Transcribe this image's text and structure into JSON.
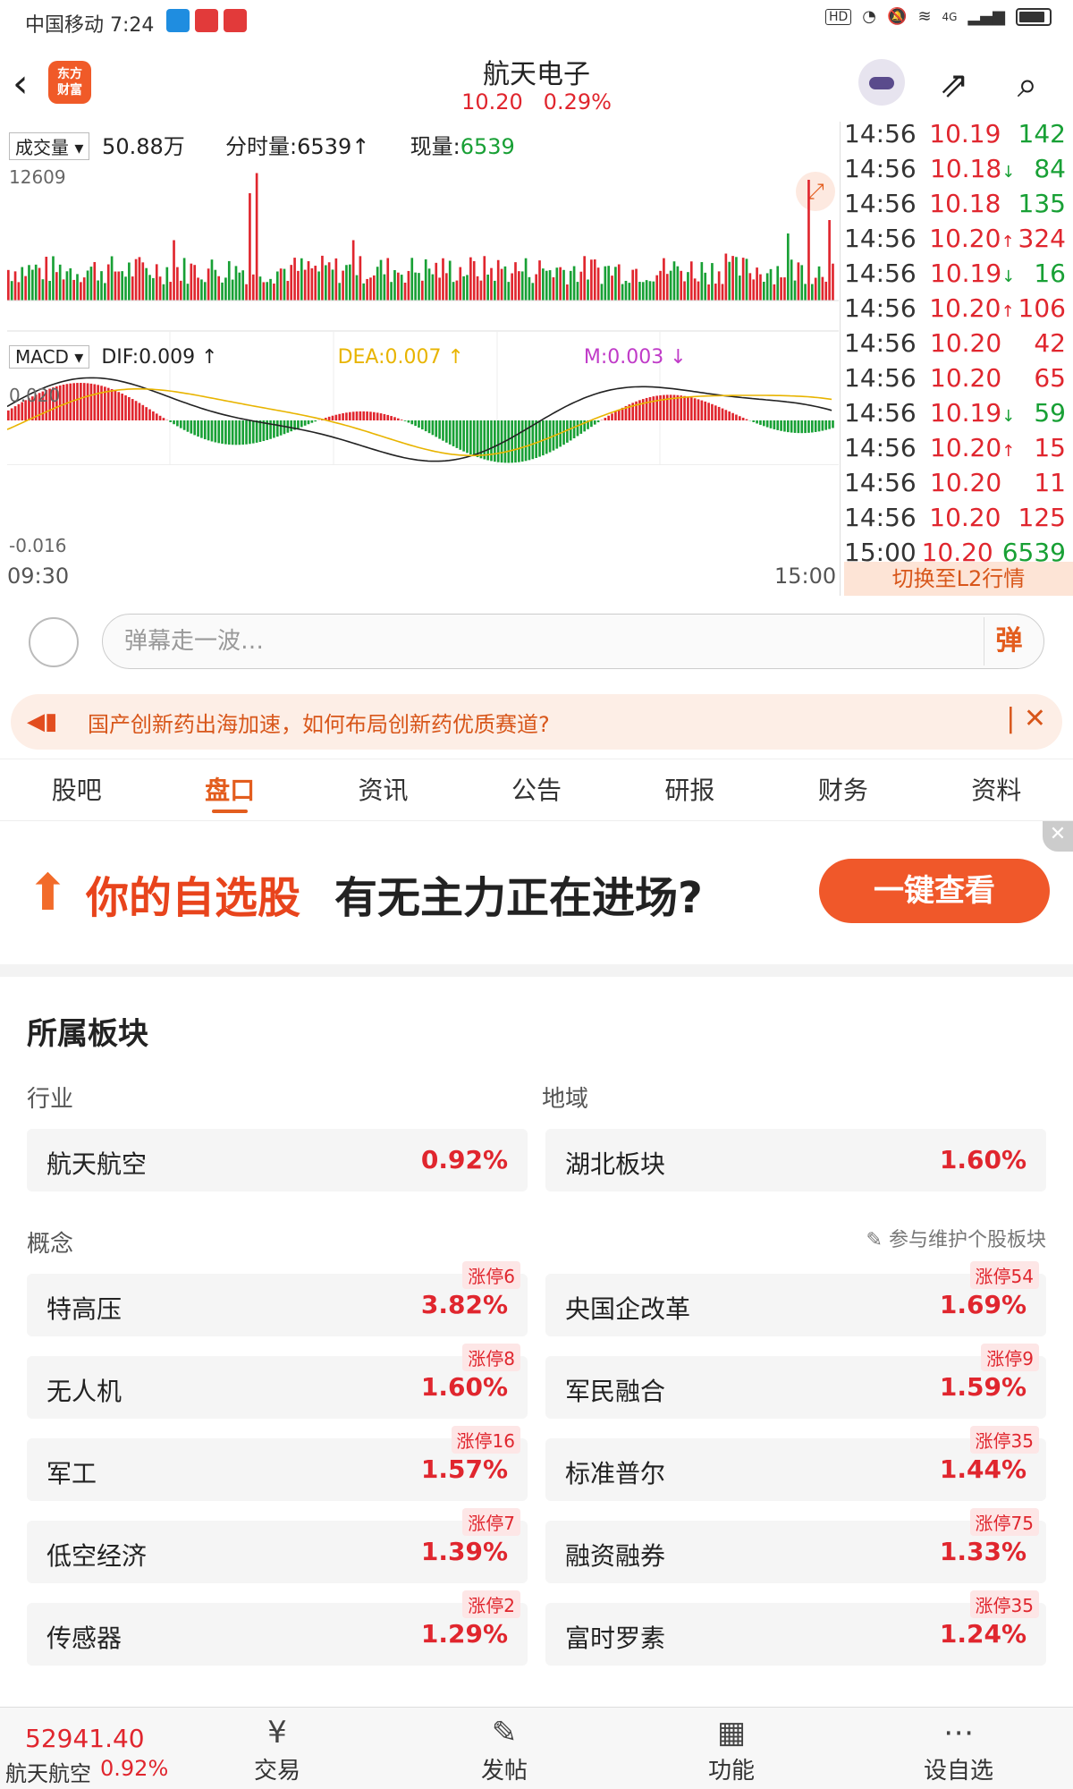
{
  "status": {
    "carrier_time": "中国移动 7:24",
    "net": "4G",
    "hd": "HD"
  },
  "header": {
    "title": "航天电子",
    "price": "10.20",
    "change": "0.29%",
    "logo": "东方\n财富"
  },
  "chart": {
    "vol_selector": "成交量",
    "vol_total": "50.88万",
    "fenshi": "分时量:6539",
    "xianliang_label": "现量:",
    "xianliang_value": "6539",
    "vol_max": "12609",
    "macd_selector": "MACD",
    "dif": "DIF:0.009",
    "dea": "DEA:0.007",
    "m": "M:0.003",
    "macd_top": "0.020",
    "macd_bottom": "-0.016",
    "time_start": "09:30",
    "time_end": "15:00"
  },
  "ticks": [
    {
      "time": "14:56",
      "price": "10.19",
      "vol": "142",
      "dir": "",
      "color": "green"
    },
    {
      "time": "14:56",
      "price": "10.18",
      "vol": "84",
      "dir": "↓",
      "color": "green"
    },
    {
      "time": "14:56",
      "price": "10.18",
      "vol": "135",
      "dir": "",
      "color": "green"
    },
    {
      "time": "14:56",
      "price": "10.20",
      "vol": "324",
      "dir": "↑",
      "color": "red"
    },
    {
      "time": "14:56",
      "price": "10.19",
      "vol": "16",
      "dir": "↓",
      "color": "green"
    },
    {
      "time": "14:56",
      "price": "10.20",
      "vol": "106",
      "dir": "↑",
      "color": "red"
    },
    {
      "time": "14:56",
      "price": "10.20",
      "vol": "42",
      "dir": "",
      "color": "red"
    },
    {
      "time": "14:56",
      "price": "10.20",
      "vol": "65",
      "dir": "",
      "color": "red"
    },
    {
      "time": "14:56",
      "price": "10.19",
      "vol": "59",
      "dir": "↓",
      "color": "green"
    },
    {
      "time": "14:56",
      "price": "10.20",
      "vol": "15",
      "dir": "↑",
      "color": "red"
    },
    {
      "time": "14:56",
      "price": "10.20",
      "vol": "11",
      "dir": "",
      "color": "red"
    },
    {
      "time": "14:56",
      "price": "10.20",
      "vol": "125",
      "dir": "",
      "color": "red"
    },
    {
      "time": "15:00",
      "price": "10.20",
      "vol": "6539",
      "dir": "",
      "color": "green"
    }
  ],
  "l2_button": "切换至L2行情",
  "danmaku": {
    "placeholder": "弹幕走一波…",
    "button": "弹"
  },
  "news": {
    "text": "国产创新药出海加速，如何布局创新药优质赛道?"
  },
  "tabs": [
    "股吧",
    "盘口",
    "资讯",
    "公告",
    "研报",
    "财务",
    "资料"
  ],
  "active_tab": "盘口",
  "ad": {
    "highlight": "你的自选股",
    "text": "有无主力正在进场?",
    "button": "一键查看"
  },
  "sectors": {
    "title": "所属板块",
    "industry_label": "行业",
    "region_label": "地域",
    "concept_label": "概念",
    "maintain_link": "参与维护个股板块",
    "industry": {
      "name": "航天航空",
      "pct": "0.92%"
    },
    "region": {
      "name": "湖北板块",
      "pct": "1.60%"
    },
    "concepts": [
      {
        "name": "特高压",
        "pct": "3.82%",
        "badge": "涨停6"
      },
      {
        "name": "央国企改革",
        "pct": "1.69%",
        "badge": "涨停54"
      },
      {
        "name": "无人机",
        "pct": "1.60%",
        "badge": "涨停8"
      },
      {
        "name": "军民融合",
        "pct": "1.59%",
        "badge": "涨停9"
      },
      {
        "name": "军工",
        "pct": "1.57%",
        "badge": "涨停16"
      },
      {
        "name": "标准普尔",
        "pct": "1.44%",
        "badge": "涨停35"
      },
      {
        "name": "低空经济",
        "pct": "1.39%",
        "badge": "涨停7"
      },
      {
        "name": "融资融券",
        "pct": "1.33%",
        "badge": "涨停75"
      },
      {
        "name": "传感器",
        "pct": "1.29%",
        "badge": "涨停2"
      },
      {
        "name": "富时罗素",
        "pct": "1.24%",
        "badge": "涨停35"
      }
    ]
  },
  "bottom": {
    "index_value": "52941.40",
    "index_name": "航天航空",
    "index_change": "0.92%",
    "items": [
      "交易",
      "发帖",
      "功能",
      "设自选"
    ]
  },
  "colors": {
    "accent": "#e35d1e",
    "up": "#e0262e",
    "down": "#18a035"
  }
}
